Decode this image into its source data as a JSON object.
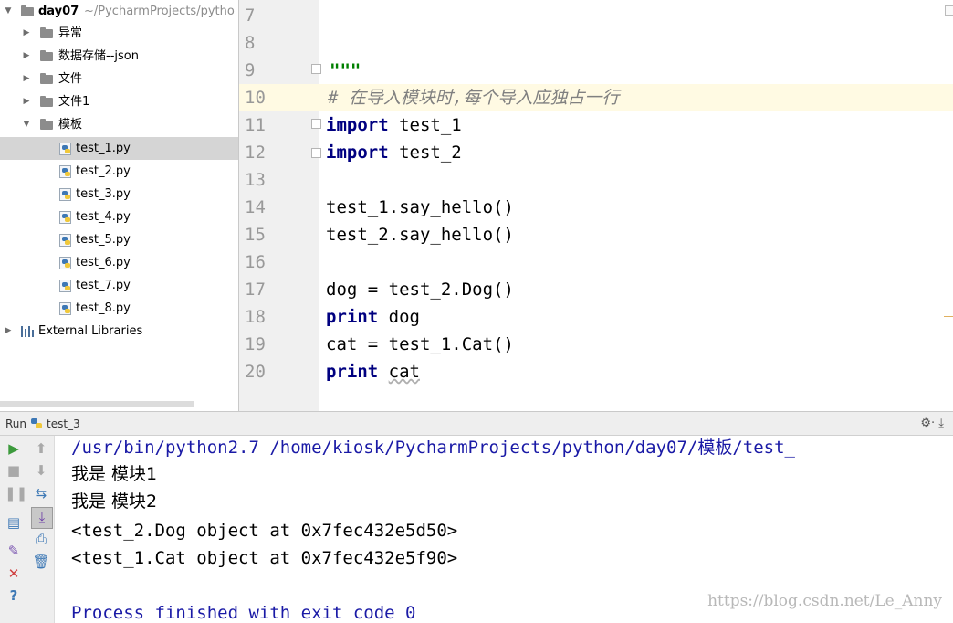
{
  "project_tree": {
    "root": {
      "name": "day07",
      "path_hint": "~/PycharmProjects/pytho"
    },
    "folders": [
      "异常",
      "数据存储--json",
      "文件",
      "文件1",
      "模板"
    ],
    "files": [
      "test_1.py",
      "test_2.py",
      "test_3.py",
      "test_4.py",
      "test_5.py",
      "test_6.py",
      "test_7.py",
      "test_8.py"
    ],
    "selected_file": "test_1.py",
    "external": "External Libraries"
  },
  "editor": {
    "line_numbers": [
      "7",
      "8",
      "9",
      "10",
      "11",
      "12",
      "13",
      "14",
      "15",
      "16",
      "17",
      "18",
      "19",
      "20"
    ],
    "code": {
      "l9": "\"\"\"",
      "l10": "# 在导入模块时,每个导入应独占一行",
      "l11_kw": "import",
      "l11_rest": " test_1",
      "l12_kw": "import",
      "l12_rest": " test_2",
      "l14": "test_1.say_hello()",
      "l15": "test_2.say_hello()",
      "l17": "dog = test_2.Dog()",
      "l18_kw": "print",
      "l18_rest": " dog",
      "l19": "cat = test_1.Cat()",
      "l20_kw": "print",
      "l20_rest": "cat"
    }
  },
  "run": {
    "title": "Run",
    "config": "test_3",
    "tools": "⚙· ⤓",
    "output": {
      "cmd": "/usr/bin/python2.7 /home/kiosk/PycharmProjects/python/day07/模板/test_",
      "line1": "我是 模块1",
      "line2": "我是 模块2",
      "line3": "<test_2.Dog object at 0x7fec432e5d50>",
      "line4": "<test_1.Cat object at 0x7fec432e5f90>",
      "exit": "Process finished with exit code 0"
    }
  },
  "watermark": "https://blog.csdn.net/Le_Anny",
  "colors": {
    "keyword": "#000080",
    "comment": "#808080",
    "docstring": "#008000",
    "line_number": "#999999",
    "console_blue": "#1a1aa6",
    "selection": "#d5d5d5",
    "current_line": "#fffae3"
  }
}
